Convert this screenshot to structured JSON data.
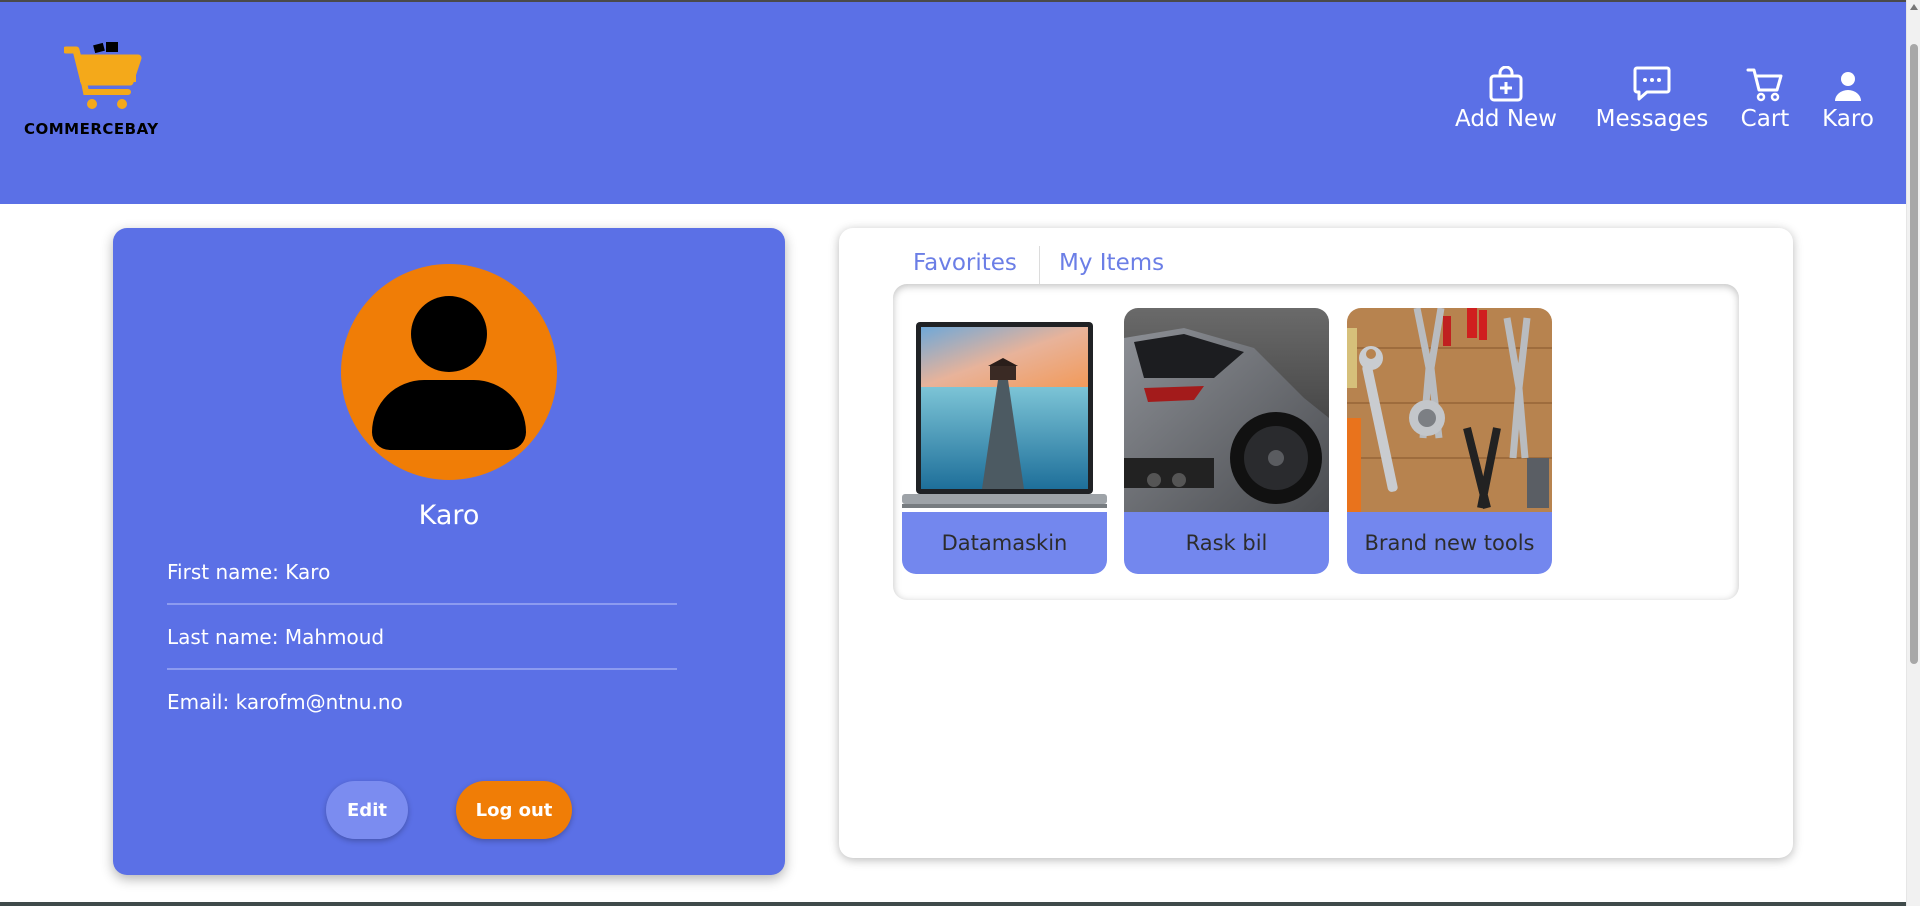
{
  "header": {
    "logo_text": "COMMERCEBAY",
    "nav": {
      "add_new": "Add New",
      "messages": "Messages",
      "cart": "Cart",
      "user": "Karo"
    }
  },
  "profile": {
    "name": "Karo",
    "first_name": "First name: Karo",
    "last_name": "Last name: Mahmoud",
    "email": "Email: karofm@ntnu.no",
    "edit_label": "Edit",
    "logout_label": "Log out"
  },
  "tabs": {
    "favorites": "Favorites",
    "my_items": "My Items"
  },
  "items": [
    {
      "title": "Datamaskin",
      "icon": "laptop-image"
    },
    {
      "title": "Rask bil",
      "icon": "car-image"
    },
    {
      "title": "Brand new tools",
      "icon": "tools-image"
    }
  ],
  "colors": {
    "primary": "#5b70e6",
    "accent": "#f07d06",
    "item_label_bg": "#7387ee",
    "tab_text": "#6b7ee6"
  }
}
